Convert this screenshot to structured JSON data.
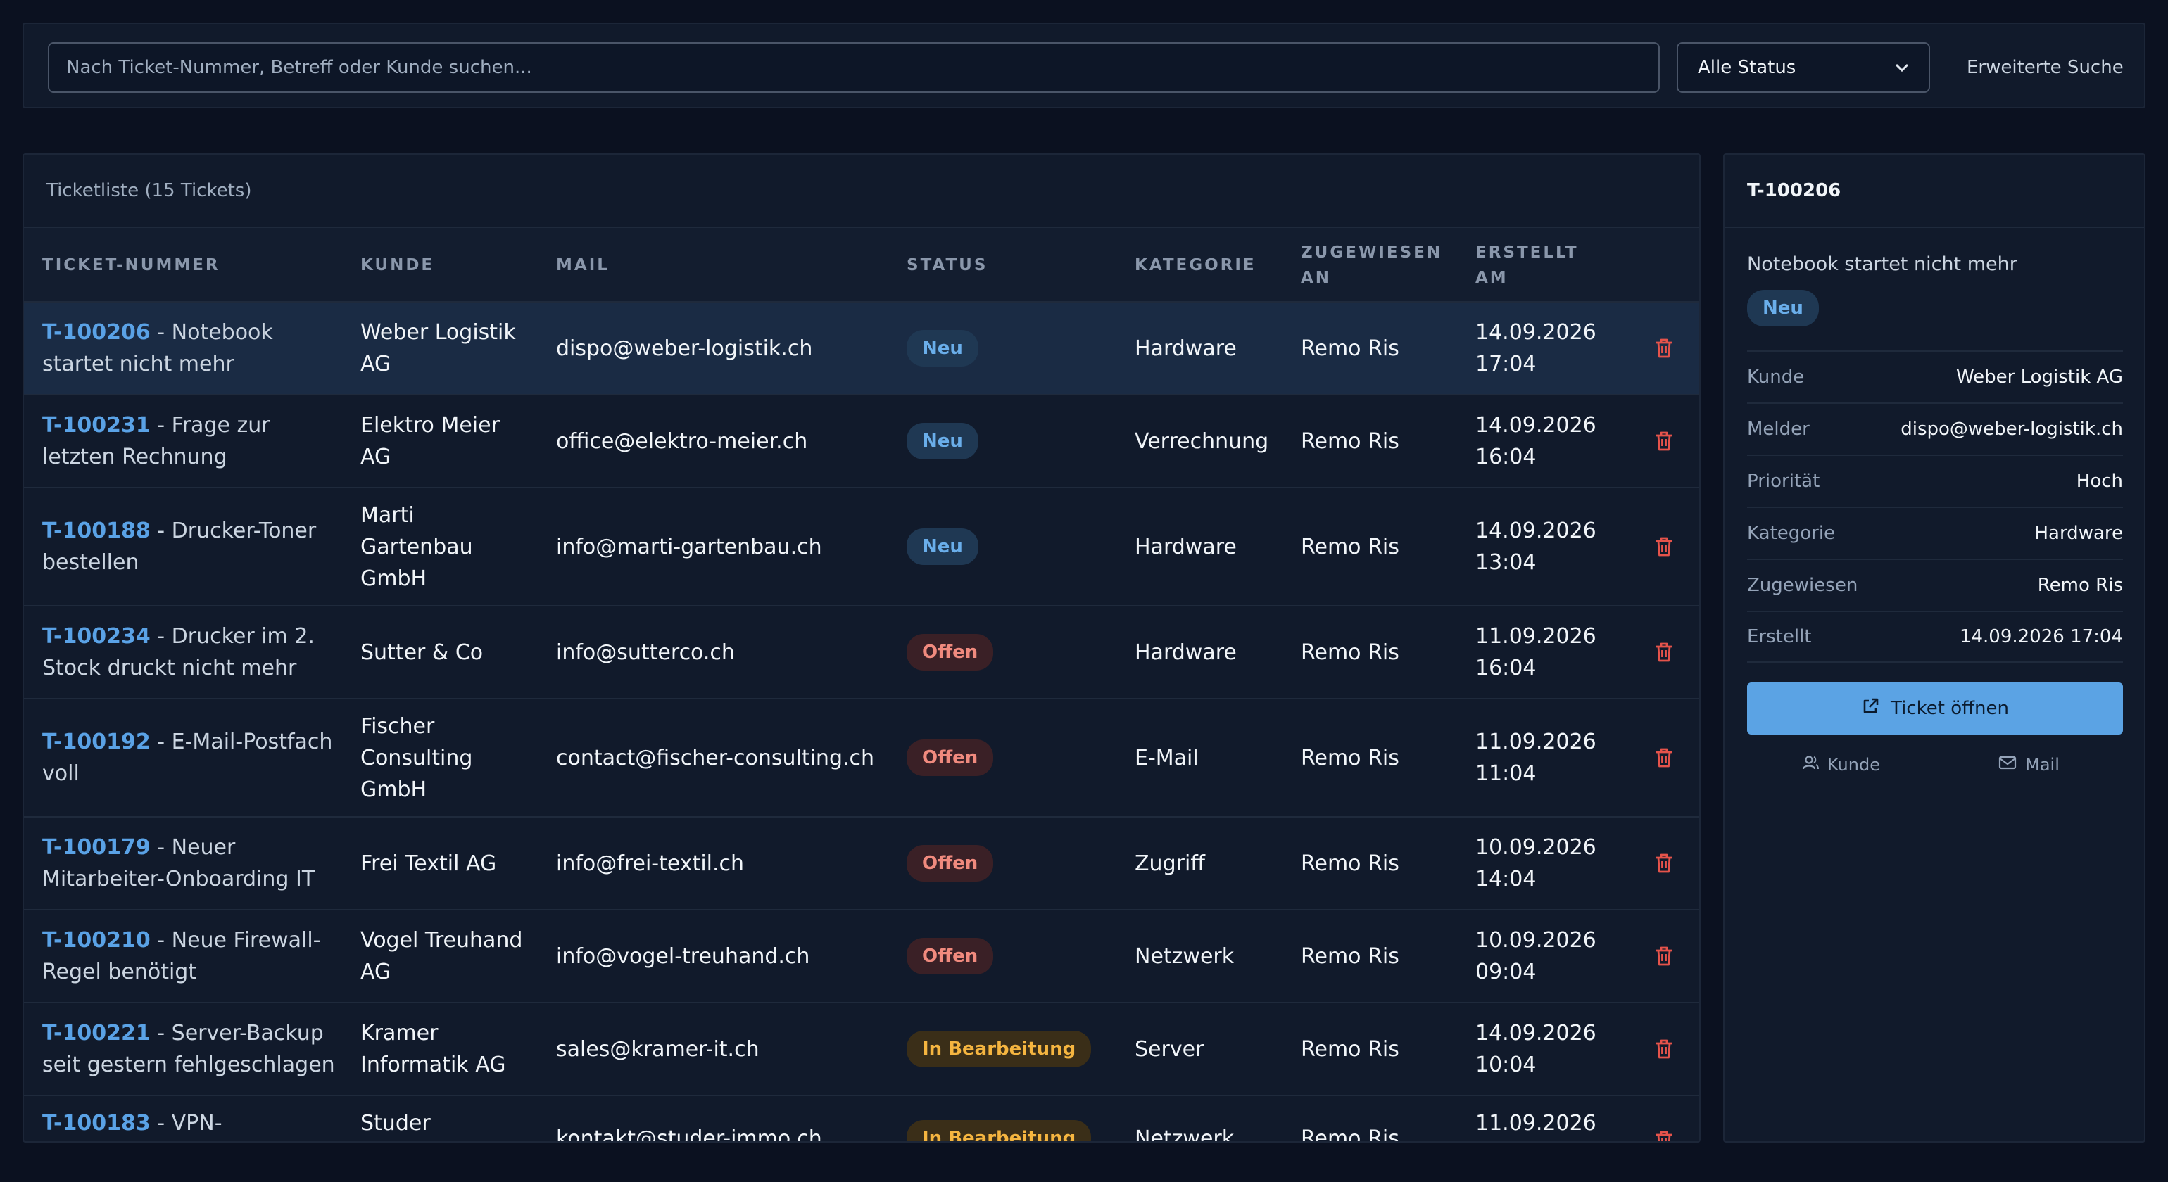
{
  "toolbar": {
    "search_placeholder": "Nach Ticket-Nummer, Betreff oder Kunde suchen...",
    "status_selected": "Alle Status",
    "advanced_search": "Erweiterte Suche"
  },
  "list": {
    "title": "Ticketliste (15 Tickets)",
    "columns": {
      "ticket": "TICKET-NUMMER",
      "kunde": "KUNDE",
      "mail": "MAIL",
      "status": "STATUS",
      "kategorie": "KATEGORIE",
      "zugewiesen_1": "ZUGEWIESEN",
      "zugewiesen_2": "AN",
      "erstellt_1": "ERSTELLT",
      "erstellt_2": "AM"
    },
    "rows": [
      {
        "id": "T-100206",
        "subject_1": " - Notebook",
        "subject_2": "startet nicht mehr",
        "kunde_1": "Weber Logistik",
        "kunde_2": "AG",
        "kunde_3": "",
        "mail": "dispo@weber-logistik.ch",
        "status": "Neu",
        "kategorie": "Hardware",
        "zugewiesen": "Remo Ris",
        "date": "14.09.2026",
        "time": "17:04"
      },
      {
        "id": "T-100231",
        "subject_1": " - Frage zur",
        "subject_2": "letzten Rechnung",
        "kunde_1": "Elektro Meier",
        "kunde_2": "AG",
        "kunde_3": "",
        "mail": "office@elektro-meier.ch",
        "status": "Neu",
        "kategorie": "Verrechnung",
        "zugewiesen": "Remo Ris",
        "date": "14.09.2026",
        "time": "16:04"
      },
      {
        "id": "T-100188",
        "subject_1": " - Drucker-Toner",
        "subject_2": "bestellen",
        "kunde_1": "Marti",
        "kunde_2": "Gartenbau",
        "kunde_3": "GmbH",
        "mail": "info@marti-gartenbau.ch",
        "status": "Neu",
        "kategorie": "Hardware",
        "zugewiesen": "Remo Ris",
        "date": "14.09.2026",
        "time": "13:04"
      },
      {
        "id": "T-100234",
        "subject_1": " - Drucker im 2.",
        "subject_2": "Stock druckt nicht mehr",
        "kunde_1": "Sutter & Co",
        "kunde_2": "",
        "kunde_3": "",
        "mail": "info@sutterco.ch",
        "status": "Offen",
        "kategorie": "Hardware",
        "zugewiesen": "Remo Ris",
        "date": "11.09.2026",
        "time": "16:04"
      },
      {
        "id": "T-100192",
        "subject_1": " - E-Mail-Postfach",
        "subject_2": "voll",
        "kunde_1": "Fischer",
        "kunde_2": "Consulting",
        "kunde_3": "GmbH",
        "mail": "contact@fischer-consulting.ch",
        "status": "Offen",
        "kategorie": "E-Mail",
        "zugewiesen": "Remo Ris",
        "date": "11.09.2026",
        "time": "11:04"
      },
      {
        "id": "T-100179",
        "subject_1": " - Neuer",
        "subject_2": "Mitarbeiter-Onboarding IT",
        "kunde_1": "Frei Textil AG",
        "kunde_2": "",
        "kunde_3": "",
        "mail": "info@frei-textil.ch",
        "status": "Offen",
        "kategorie": "Zugriff",
        "zugewiesen": "Remo Ris",
        "date": "10.09.2026",
        "time": "14:04"
      },
      {
        "id": "T-100210",
        "subject_1": " - Neue Firewall-",
        "subject_2": "Regel benötigt",
        "kunde_1": "Vogel Treuhand",
        "kunde_2": "AG",
        "kunde_3": "",
        "mail": "info@vogel-treuhand.ch",
        "status": "Offen",
        "kategorie": "Netzwerk",
        "zugewiesen": "Remo Ris",
        "date": "10.09.2026",
        "time": "09:04"
      },
      {
        "id": "T-100221",
        "subject_1": " - Server-Backup",
        "subject_2": "seit gestern fehlgeschlagen",
        "kunde_1": "Kramer",
        "kunde_2": "Informatik AG",
        "kunde_3": "",
        "mail": "sales@kramer-it.ch",
        "status": "In Bearbeitung",
        "kategorie": "Server",
        "zugewiesen": "Remo Ris",
        "date": "14.09.2026",
        "time": "10:04"
      },
      {
        "id": "T-100183",
        "subject_1": " - VPN-",
        "subject_2": "",
        "kunde_1": "Studer",
        "kunde_2": "",
        "kunde_3": "",
        "mail": "kontakt@studer-immo.ch",
        "status": "In Bearbeitung",
        "kategorie": "Netzwerk",
        "zugewiesen": "Remo Ris",
        "date": "11.09.2026",
        "time": ""
      }
    ]
  },
  "detail": {
    "ticket_id": "T-100206",
    "subject": "Notebook startet nicht mehr",
    "status": "Neu",
    "fields": [
      {
        "key": "Kunde",
        "value": "Weber Logistik AG"
      },
      {
        "key": "Melder",
        "value": "dispo@weber-logistik.ch"
      },
      {
        "key": "Priorität",
        "value": "Hoch"
      },
      {
        "key": "Kategorie",
        "value": "Hardware"
      },
      {
        "key": "Zugewiesen",
        "value": "Remo Ris"
      },
      {
        "key": "Erstellt",
        "value": "14.09.2026 17:04"
      }
    ],
    "open_button": "Ticket öffnen",
    "link_kunde": "Kunde",
    "link_mail": "Mail"
  },
  "colors": {
    "background": "#0b1120",
    "panel": "#111a2b",
    "accent": "#5ba3e4",
    "status_neu": "#6aaeea",
    "status_offen": "#f08a7e",
    "status_bearbeitung": "#f5b540",
    "delete": "#e5534b"
  },
  "icons": {
    "row_action": "trash-icon",
    "open_button": "external-link-icon",
    "kunde_link": "user-icon",
    "mail_link": "mail-icon",
    "select": "chevron-down-icon"
  }
}
